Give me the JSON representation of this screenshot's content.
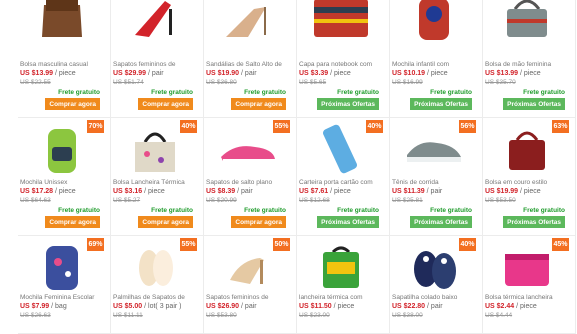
{
  "products": [
    {
      "title": "Bolsa masculina casual",
      "price": "US $13.99",
      "unit": "/ piece",
      "old": "US $22.55",
      "badge": "",
      "ship": "Frete gratuito",
      "button": "Comprar agora",
      "btn": "buy",
      "icon": "messenger-bag-icon",
      "color": "#7a4a2a"
    },
    {
      "title": "Sapatos femininos de",
      "price": "US $29.99",
      "unit": "/ pair",
      "old": "US $51.74",
      "badge": "",
      "ship": "Frete gratuito",
      "button": "Comprar agora",
      "btn": "buy",
      "icon": "heel-sandal-icon",
      "color": "#d2232a"
    },
    {
      "title": "Sandálias de Salto Alto de",
      "price": "US $19.90",
      "unit": "/ pair",
      "old": "US $36.80",
      "badge": "",
      "ship": "Frete gratuito",
      "button": "Comprar agora",
      "btn": "buy",
      "icon": "nude-heel-icon",
      "color": "#d9b08c"
    },
    {
      "title": "Capa para notebook com",
      "price": "US $3.39",
      "unit": "/ piece",
      "old": "US $5.65",
      "badge": "",
      "ship": "Frete gratuito",
      "button": "Próximas Ofertas",
      "btn": "next",
      "icon": "laptop-sleeve-icon",
      "color": "#c0392b"
    },
    {
      "title": "Mochila infantil com",
      "price": "US $10.19",
      "unit": "/ piece",
      "old": "US $16.99",
      "badge": "",
      "ship": "Frete gratuito",
      "button": "Próximas Ofertas",
      "btn": "next",
      "icon": "kids-backpack-icon",
      "color": "#c0392b"
    },
    {
      "title": "Bolsa de mão feminina",
      "price": "US $13.99",
      "unit": "/ piece",
      "old": "US $35.70",
      "badge": "",
      "ship": "Frete gratuito",
      "button": "Próximas Ofertas",
      "btn": "next",
      "icon": "handbag-icon",
      "color": "#7f8c8d"
    },
    {
      "title": "Mochila Unissex",
      "price": "US $17.28",
      "unit": "/ piece",
      "old": "US $64.63",
      "badge": "70%",
      "ship": "Frete gratuito",
      "button": "Comprar agora",
      "btn": "buy",
      "icon": "hiking-backpack-icon",
      "color": "#8cc63f"
    },
    {
      "title": "Bolsa Lancheira Térmica",
      "price": "US $3.16",
      "unit": "/ piece",
      "old": "US $5.27",
      "badge": "40%",
      "ship": "Frete gratuito",
      "button": "Comprar agora",
      "btn": "buy",
      "icon": "tote-bag-icon",
      "color": "#e0d9c8"
    },
    {
      "title": "Sapatos de salto plano",
      "price": "US $8.39",
      "unit": "/ pair",
      "old": "US $20.99",
      "badge": "55%",
      "ship": "Frete gratuito",
      "button": "Comprar agora",
      "btn": "buy",
      "icon": "pink-flat-shoe-icon",
      "color": "#e84d8a"
    },
    {
      "title": "Carteira porta cartão com",
      "price": "US $7.61",
      "unit": "/ piece",
      "old": "US $12.68",
      "badge": "40%",
      "ship": "Frete gratuito",
      "button": "Próximas Ofertas",
      "btn": "next",
      "icon": "phone-wallet-icon",
      "color": "#5dade2"
    },
    {
      "title": "Tênis de corrida",
      "price": "US $11.39",
      "unit": "/ pair",
      "old": "US $25.81",
      "badge": "56%",
      "ship": "Frete gratuito",
      "button": "Próximas Ofertas",
      "btn": "next",
      "icon": "sneaker-icon",
      "color": "#7f8c8d"
    },
    {
      "title": "Bolsa em couro estilo",
      "price": "US $19.99",
      "unit": "/ piece",
      "old": "US $53.50",
      "badge": "63%",
      "ship": "Frete gratuito",
      "button": "Próximas Ofertas",
      "btn": "next",
      "icon": "leather-handbag-icon",
      "color": "#8b1e1e"
    },
    {
      "title": "Mochila Feminina Escolar",
      "price": "US $7.99",
      "unit": "/ bag",
      "old": "US $26.63",
      "badge": "69%",
      "ship": "",
      "button": "",
      "btn": "",
      "icon": "galaxy-backpack-icon",
      "color": "#3b4f9e"
    },
    {
      "title": "Palmilhas de Sapatos de",
      "price": "US $5.00",
      "unit": "/ lot( 3 pair )",
      "old": "US $11.11",
      "badge": "55%",
      "ship": "",
      "button": "",
      "btn": "",
      "icon": "insole-icon",
      "color": "#f3e2c7"
    },
    {
      "title": "Sapatos femininos de",
      "price": "US $26.90",
      "unit": "/ pair",
      "old": "US $53.80",
      "badge": "50%",
      "ship": "",
      "button": "",
      "btn": "",
      "icon": "beige-pump-icon",
      "color": "#e5c9a3"
    },
    {
      "title": "lancheira térmica com",
      "price": "US $11.50",
      "unit": "/ piece",
      "old": "US $23.00",
      "badge": "",
      "ship": "",
      "button": "",
      "btn": "",
      "icon": "lunch-box-icon",
      "color": "#3aa33a"
    },
    {
      "title": "Sapatilha colado baixo",
      "price": "US $22.80",
      "unit": "/ pair",
      "old": "US $38.00",
      "badge": "40%",
      "ship": "",
      "button": "",
      "btn": "",
      "icon": "ballet-flat-icon",
      "color": "#1f2a5a"
    },
    {
      "title": "Bolsa térmica lancheira",
      "price": "US $2.44",
      "unit": "/ piece",
      "old": "US $4.44",
      "badge": "45%",
      "ship": "",
      "button": "",
      "btn": "",
      "icon": "pink-cooler-bag-icon",
      "color": "#e8378a"
    }
  ]
}
